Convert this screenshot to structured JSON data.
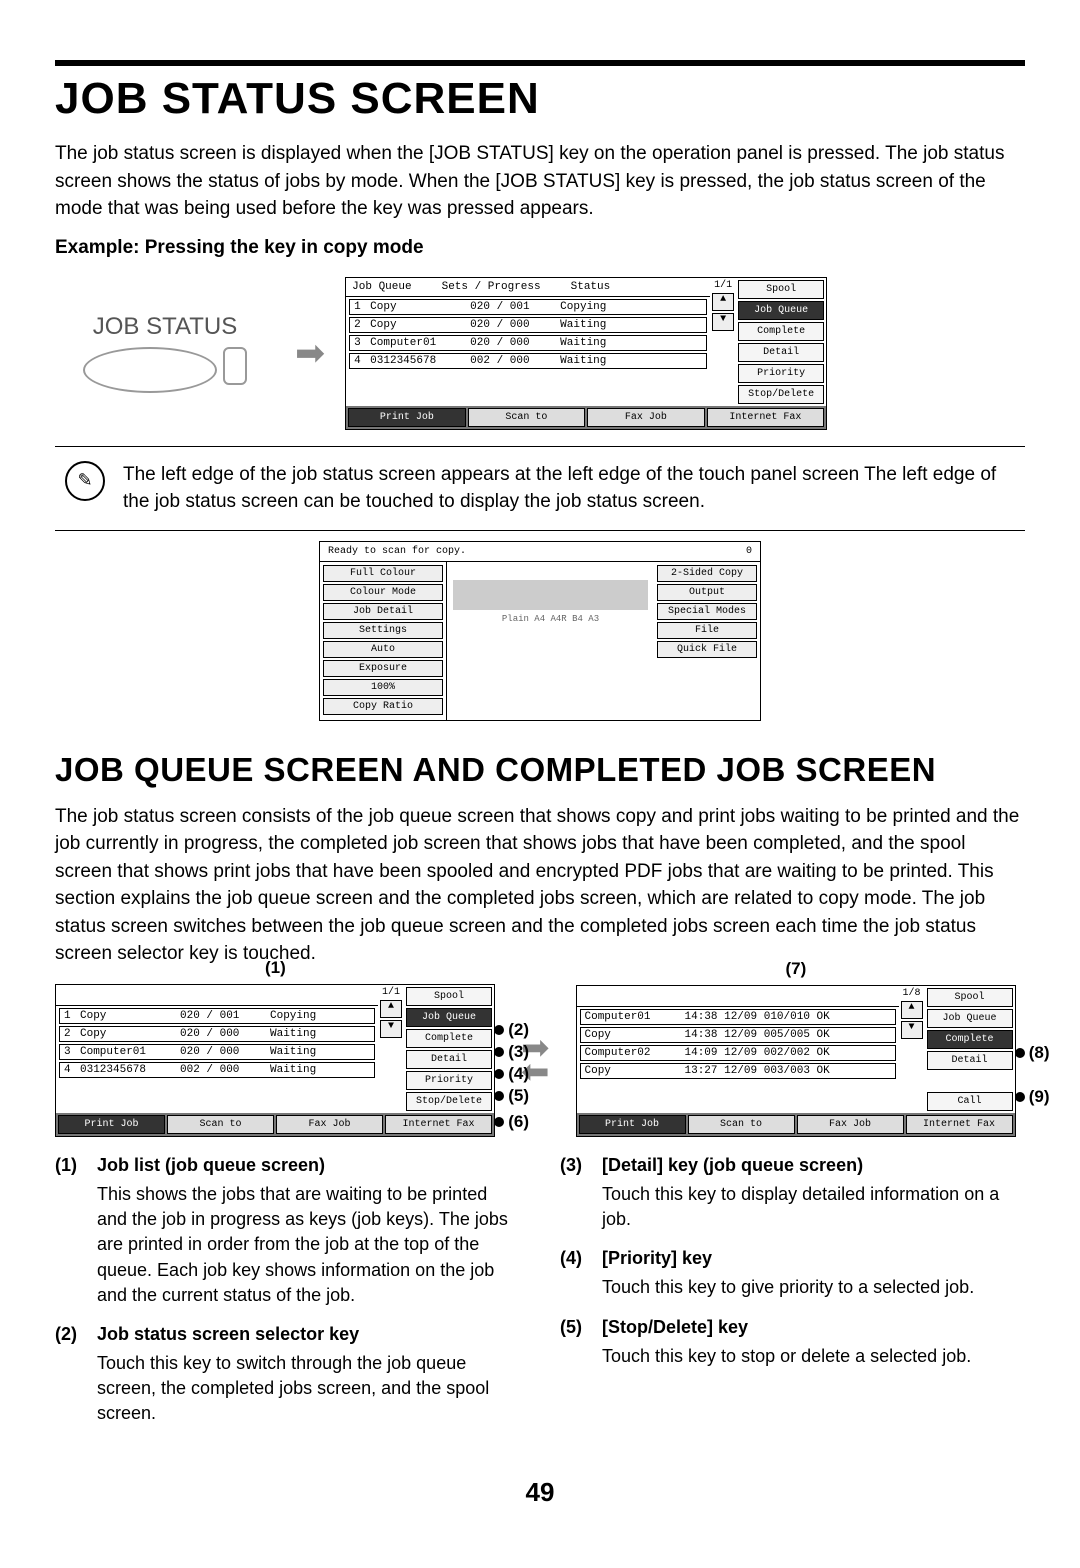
{
  "title": "JOB STATUS SCREEN",
  "intro": "The job status screen is displayed when the [JOB STATUS] key on the operation panel is pressed. The job status screen shows the status of jobs by mode. When the [JOB STATUS] key is pressed, the job status screen of the mode that was being used before the key was pressed appears.",
  "exampleLabel": "Example: Pressing the key in copy mode",
  "jobStatusBtn": "JOB STATUS",
  "mainPanel": {
    "headers": {
      "queue": "Job Queue",
      "sets": "Sets / Progress",
      "status": "Status"
    },
    "rows": [
      {
        "n": "1",
        "name": "Copy",
        "sets": "020 / 001",
        "status": "Copying",
        "page": "1/1"
      },
      {
        "n": "2",
        "name": "Copy",
        "sets": "020 / 000",
        "status": "Waiting"
      },
      {
        "n": "3",
        "name": "Computer01",
        "sets": "020 / 000",
        "status": "Waiting"
      },
      {
        "n": "4",
        "name": "0312345678",
        "sets": "002 / 000",
        "status": "Waiting"
      }
    ],
    "btns": {
      "spool": "Spool",
      "jobq": "Job Queue",
      "complete": "Complete",
      "detail": "Detail",
      "priority": "Priority",
      "stop": "Stop/Delete"
    },
    "tabs": {
      "print": "Print Job",
      "scan": "Scan to",
      "fax": "Fax Job",
      "ifax": "Internet Fax"
    }
  },
  "noteText": "The left edge of the job status screen appears at the left edge of the touch panel screen The left edge of the job status screen can be touched to display the job status screen.",
  "copyPanel": {
    "ready": "Ready to scan for copy.",
    "count": "0",
    "l": [
      "Full Colour",
      "Colour Mode",
      "Job Detail",
      "Settings",
      "Auto",
      "Exposure",
      "100%",
      "Copy Ratio"
    ],
    "m": "Plain\nA4\nA4R\nB4\nA3",
    "r": [
      "2-Sided Copy",
      "Output",
      "Special Modes",
      "File",
      "Quick File"
    ]
  },
  "title2": "JOB QUEUE SCREEN AND COMPLETED JOB SCREEN",
  "intro2": "The job status screen consists of the job queue screen that shows copy and print jobs waiting to be printed and the job currently in progress, the completed job screen that shows jobs that have been completed, and the spool screen that shows print jobs that have been spooled and encrypted PDF jobs that are waiting to be printed. This section explains the job queue screen and the completed jobs screen, which are related to copy mode. The job status screen switches between the job queue screen and the completed jobs screen each time the job status screen selector key is touched.",
  "leftScreen": {
    "label1": "(1)",
    "rows": [
      {
        "n": "1",
        "name": "Copy",
        "sets": "020 / 001",
        "status": "Copying",
        "page": "1/1"
      },
      {
        "n": "2",
        "name": "Copy",
        "sets": "020 / 000",
        "status": "Waiting"
      },
      {
        "n": "3",
        "name": "Computer01",
        "sets": "020 / 000",
        "status": "Waiting"
      },
      {
        "n": "4",
        "name": "0312345678",
        "sets": "002 / 000",
        "status": "Waiting"
      }
    ],
    "btns": {
      "spool": "Spool",
      "jobq": "Job Queue",
      "complete": "Complete",
      "detail": "Detail",
      "priority": "Priority",
      "stop": "Stop/Delete"
    }
  },
  "rightScreen": {
    "label7": "(7)",
    "rows": [
      {
        "name": "Computer01",
        "sets": "14:38 12/09 010/010 OK",
        "page": "1/8"
      },
      {
        "name": "Copy",
        "sets": "14:38 12/09 005/005 OK"
      },
      {
        "name": "Computer02",
        "sets": "14:09 12/09 002/002 OK"
      },
      {
        "name": "Copy",
        "sets": "13:27 12/09 003/003 OK"
      }
    ],
    "btns": {
      "spool": "Spool",
      "jobq": "Job Queue",
      "complete": "Complete",
      "detail": "Detail",
      "call": "Call"
    }
  },
  "callouts": {
    "c2": "(2)",
    "c3": "(3)",
    "c4": "(4)",
    "c5": "(5)",
    "c6": "(6)",
    "c8": "(8)",
    "c9": "(9)"
  },
  "desc": {
    "1": {
      "h": "Job list (job queue screen)",
      "t": "This shows the jobs that are waiting to be printed and the job in progress as keys (job keys). The jobs are printed in order from the job at the top of the queue. Each job key shows information on the job and the current status of the job."
    },
    "2": {
      "h": "Job status screen selector key",
      "t": "Touch this key to switch through the job queue screen, the completed jobs screen, and the spool screen."
    },
    "3": {
      "h": "[Detail] key (job queue screen)",
      "t": "Touch this key to display detailed information on a job."
    },
    "4": {
      "h": "[Priority] key",
      "t": "Touch this key to give priority to a selected job."
    },
    "5": {
      "h": "[Stop/Delete] key",
      "t": "Touch this key to stop or delete a selected job."
    }
  },
  "pageNum": "49"
}
